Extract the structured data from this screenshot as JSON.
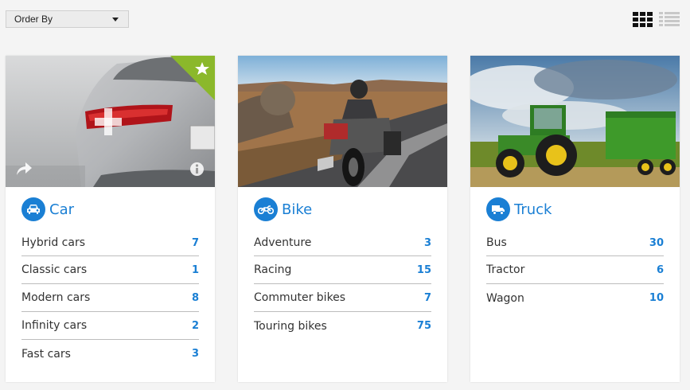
{
  "toolbar": {
    "order_by_label": "Order By"
  },
  "colors": {
    "accent": "#1a7fd4",
    "badge": "#8bb82b",
    "background": "#f4f4f4"
  },
  "categories": [
    {
      "title": "Car",
      "icon": "car-icon",
      "items": [
        {
          "label": "Hybrid cars",
          "count": "7"
        },
        {
          "label": "Classic cars",
          "count": "1"
        },
        {
          "label": "Modern cars",
          "count": "8"
        },
        {
          "label": "Infinity cars",
          "count": "2"
        },
        {
          "label": "Fast cars",
          "count": "3"
        }
      ]
    },
    {
      "title": "Bike",
      "icon": "motorcycle-icon",
      "items": [
        {
          "label": "Adventure",
          "count": "3"
        },
        {
          "label": "Racing",
          "count": "15"
        },
        {
          "label": "Commuter bikes",
          "count": "7"
        },
        {
          "label": "Touring bikes",
          "count": "75"
        }
      ]
    },
    {
      "title": "Truck",
      "icon": "truck-icon",
      "items": [
        {
          "label": "Bus",
          "count": "30"
        },
        {
          "label": "Tractor",
          "count": "6"
        },
        {
          "label": "Wagon",
          "count": "10"
        }
      ]
    }
  ]
}
